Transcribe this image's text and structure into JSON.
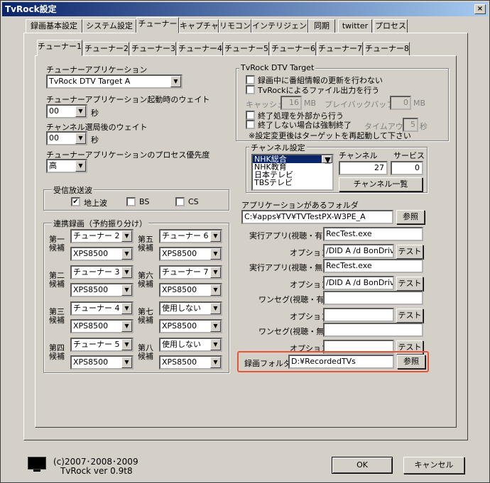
{
  "window": {
    "title": "TvRock設定",
    "close": "×"
  },
  "tabs": [
    "録画基本設定",
    "システム設定",
    "チューナー",
    "キャプチャ",
    "リモコン",
    "インテリジェント",
    "同期",
    "twitter",
    "プロセス"
  ],
  "subtabs": [
    "チューナー1",
    "チューナー2",
    "チューナー3",
    "チューナー4",
    "チューナー5",
    "チューナー6",
    "チューナー7",
    "チューナー8"
  ],
  "left": {
    "app_label": "チューナーアプリケーション",
    "app_value": "TvRock DTV Target A",
    "wait_label": "チューナーアプリケーション起動時のウェイト",
    "wait_value": "00",
    "wait_unit": "秒",
    "chwait_label": "チャンネル選局後のウェイト",
    "chwait_value": "00",
    "chwait_unit": "秒",
    "prio_label": "チューナーアプリケーションのプロセス優先度",
    "prio_value": "高",
    "broadcast": {
      "title": "受信放送波",
      "items": [
        {
          "label": "地上波",
          "checked": "✔"
        },
        {
          "label": "BS",
          "checked": ""
        },
        {
          "label": "CS",
          "checked": ""
        }
      ]
    },
    "rank": {
      "title": "連携録画（予約振り分け）",
      "slots": [
        {
          "l1": "第一",
          "l2": "候補",
          "tuner": "チューナー 2",
          "device": "XPS8500"
        },
        {
          "l1": "第二",
          "l2": "候補",
          "tuner": "チューナー 3",
          "device": "XPS8500"
        },
        {
          "l1": "第三",
          "l2": "候補",
          "tuner": "チューナー 4",
          "device": "XPS8500"
        },
        {
          "l1": "第四",
          "l2": "候補",
          "tuner": "チューナー 5",
          "device": "XPS8500"
        },
        {
          "l1": "第五",
          "l2": "候補",
          "tuner": "チューナー 6",
          "device": "XPS8500"
        },
        {
          "l1": "第六",
          "l2": "候補",
          "tuner": "チューナー 7",
          "device": "XPS8500"
        },
        {
          "l1": "第七",
          "l2": "候補",
          "tuner": "使用しない",
          "device": "XPS8500"
        },
        {
          "l1": "第八",
          "l2": "候補",
          "tuner": "使用しない",
          "device": "XPS8500"
        }
      ]
    }
  },
  "right": {
    "dtv": {
      "title": "TvRock DTV Target",
      "opt1": "録画中に番組情報の更新を行わない",
      "opt2": "TvRockによるファイル出力を行う",
      "cache_label": "キャッシュ",
      "cache_value": "16",
      "cache_unit": "MB",
      "play_label": "プレイバックバッファ",
      "play_value": "0",
      "play_unit": "MB",
      "opt3": "終了処理を外部から行う",
      "opt4": "終了しない場合は強制終了",
      "timeout_label": "タイムアウト",
      "timeout_value": "5",
      "timeout_unit": "秒",
      "note": "※設定変更後はターゲットを再起動して下さい",
      "ch": {
        "title": "チャンネル設定",
        "list": [
          "NHK総合",
          "NHK教育",
          "日本テレビ",
          "TBSテレビ"
        ],
        "ch_label": "チャンネル",
        "ch_value": "27",
        "svc_label": "サービス",
        "svc_value": "0",
        "list_btn": "チャンネル一覧"
      }
    },
    "folder_label": "アプリケーションがあるフォルダ",
    "folder_value": "C:¥apps¥TV¥TVTestPX-W3PE_A",
    "browse": "参照",
    "rows": [
      {
        "label": "実行アプリ(視聴・有)",
        "value": "RecTest.exe"
      },
      {
        "label": "オプション",
        "value": "/DID A /d BonDriv",
        "btn": "テスト"
      },
      {
        "label": "実行アプリ(視聴・無)",
        "value": "RecTest.exe"
      },
      {
        "label": "オプション",
        "value": "/DID A /d BonDriv",
        "btn": "テスト"
      },
      {
        "label": "ワンセグ(視聴・有)",
        "value": ""
      },
      {
        "label": "オプション",
        "value": "",
        "btn": "テスト"
      },
      {
        "label": "ワンセグ(視聴・無)",
        "value": ""
      },
      {
        "label": "オプション",
        "value": "",
        "btn": "テスト"
      }
    ],
    "rec_label": "録画フォルダ",
    "rec_value": "D:¥RecordedTVs",
    "rec_browse": "参照"
  },
  "footer": {
    "copyright": "(c)2007･2008･2009",
    "version": "TvRock ver 0.9t8",
    "ok": "OK",
    "cancel": "キャンセル"
  }
}
